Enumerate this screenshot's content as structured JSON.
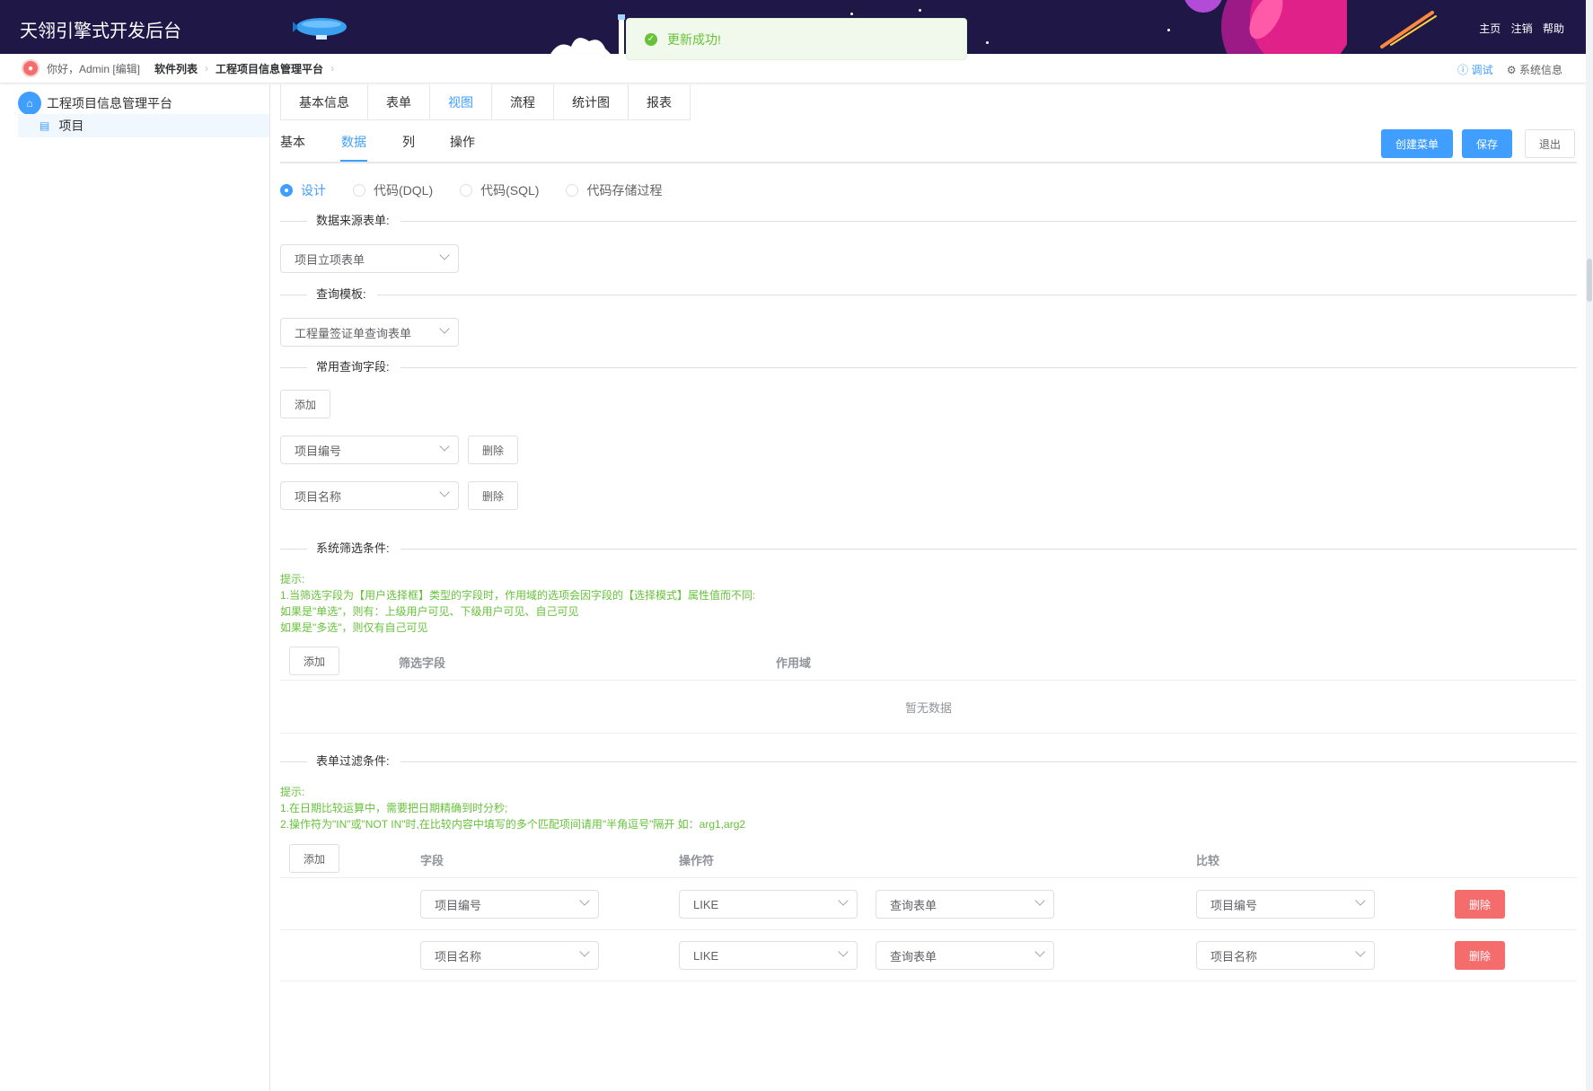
{
  "header": {
    "title": "天翎引擎式开发后台",
    "links": [
      "主页",
      "注销",
      "帮助"
    ]
  },
  "toast": {
    "message": "更新成功!",
    "icon": "check-circle-icon"
  },
  "breadcrumb": {
    "greeting": "你好，Admin [编辑]",
    "items": [
      "软件列表",
      "工程项目信息管理平台"
    ],
    "debug": "调试",
    "sysinfo": "系统信息"
  },
  "sidebar": {
    "root": "工程项目信息管理平台",
    "child": "项目"
  },
  "tabs": [
    "基本信息",
    "表单",
    "视图",
    "流程",
    "统计图",
    "报表"
  ],
  "active_tab": "视图",
  "subtabs": [
    "基本",
    "数据",
    "列",
    "操作"
  ],
  "active_subtab": "数据",
  "buttons": {
    "create_menu": "创建菜单",
    "save": "保存",
    "exit": "退出"
  },
  "radios": [
    "设计",
    "代码(DQL)",
    "代码(SQL)",
    "代码存储过程"
  ],
  "selected_radio": "设计",
  "sections": {
    "source_form": {
      "label": "数据来源表单:",
      "value": "项目立项表单"
    },
    "query_template": {
      "label": "查询模板:",
      "value": "工程量签证单查询表单"
    },
    "common_fields": {
      "label": "常用查询字段:",
      "add": "添加",
      "fields": [
        "项目编号",
        "项目名称"
      ],
      "delete": "删除"
    },
    "system_filter": {
      "label": "系统筛选条件:",
      "tips": [
        "提示:",
        "1.当筛选字段为【用户选择框】类型的字段时，作用域的选项会因字段的【选择模式】属性值而不同:",
        "如果是\"单选\"，则有：上级用户可见、下级用户可见、自己可见",
        "如果是\"多选\"，则仅有自己可见"
      ],
      "add": "添加",
      "columns": [
        "筛选字段",
        "作用域"
      ],
      "empty": "暂无数据"
    },
    "form_filter": {
      "label": "表单过滤条件:",
      "tips": [
        "提示:",
        "1.在日期比较运算中，需要把日期精确到时分秒;",
        "2.操作符为\"IN\"或\"NOT IN\"时,在比较内容中填写的多个匹配项间请用\"半角逗号\"隔开 如：arg1,arg2"
      ],
      "add": "添加",
      "columns": [
        "字段",
        "操作符",
        "比较"
      ],
      "rows": [
        {
          "field": "项目编号",
          "operator": "LIKE",
          "source": "查询表单",
          "compare": "项目编号",
          "delete": "删除"
        },
        {
          "field": "项目名称",
          "operator": "LIKE",
          "source": "查询表单",
          "compare": "项目名称",
          "delete": "删除"
        }
      ]
    }
  },
  "colors": {
    "primary": "#409eff",
    "danger": "#f56c6c",
    "success": "#67c23a",
    "header_bg": "#1f1847"
  }
}
